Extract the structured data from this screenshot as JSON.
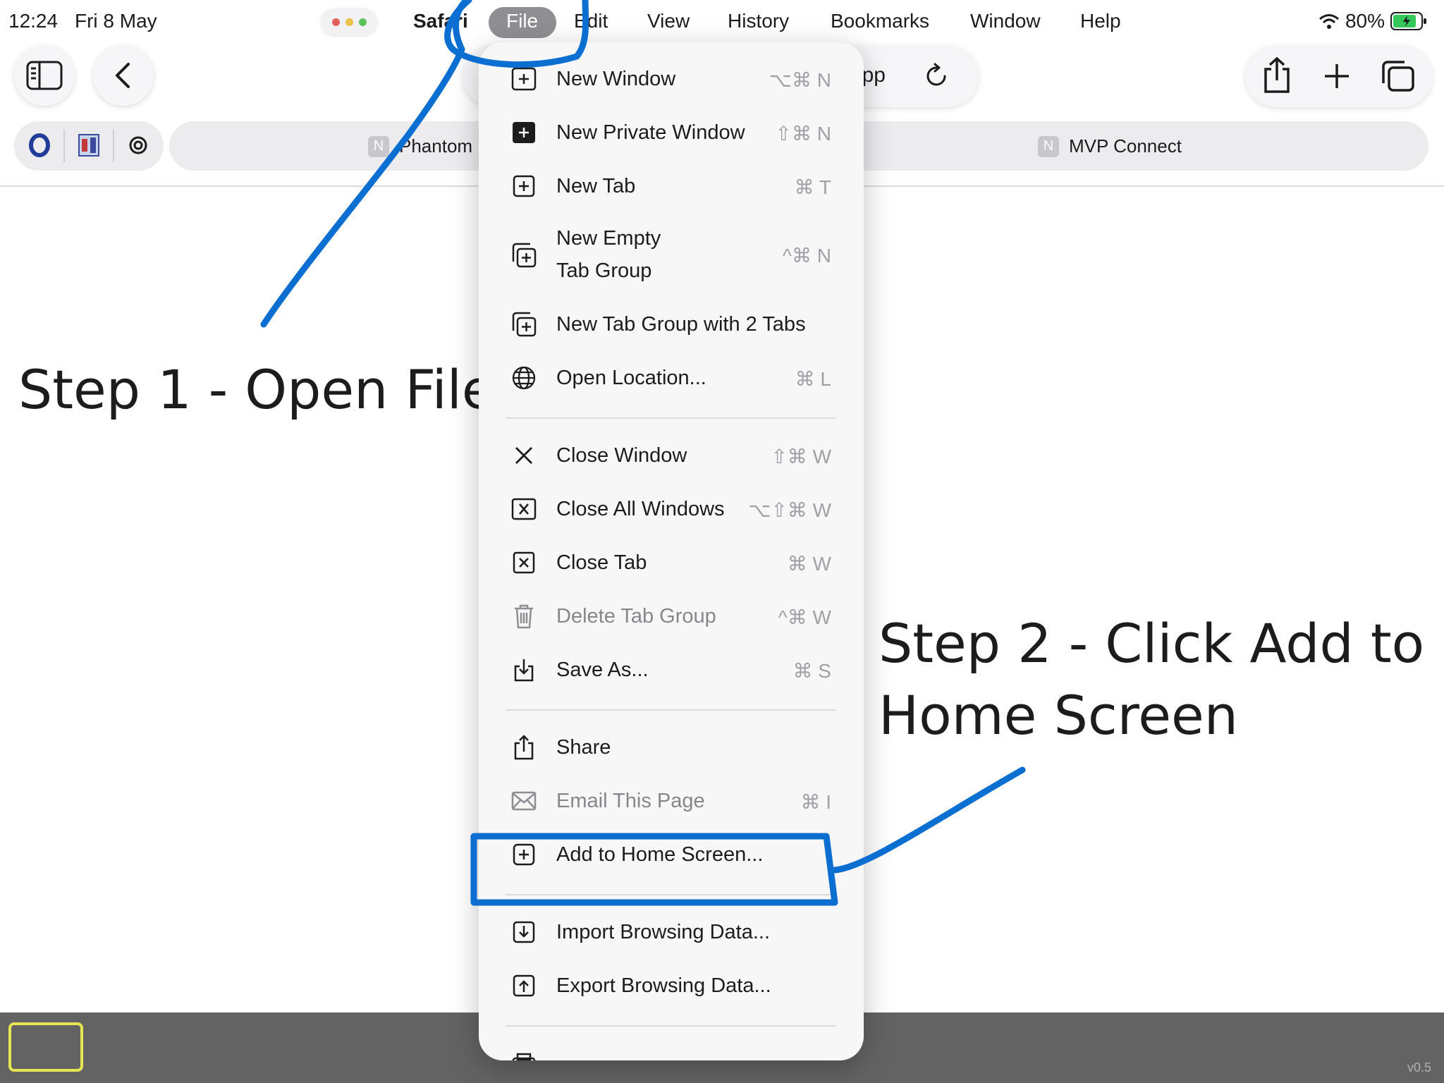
{
  "status_bar": {
    "time": "12:24",
    "date": "Fri 8 May",
    "battery": "80%"
  },
  "menubar": {
    "app": "Safari",
    "items": [
      "File",
      "Edit",
      "View",
      "History",
      "Bookmarks",
      "Window",
      "Help"
    ]
  },
  "toolbar": {
    "address_fragment": "pp"
  },
  "tabs": [
    {
      "title": "Phantom",
      "badge": "N"
    },
    {
      "title": "MVP Connect",
      "badge": "N"
    }
  ],
  "file_menu": {
    "items": [
      {
        "label": "New Window",
        "shortcut": "⌥⌘ N",
        "icon": "new-window-icon"
      },
      {
        "label": "New Private Window",
        "shortcut": "⇧⌘ N",
        "icon": "private-window-icon"
      },
      {
        "label": "New Tab",
        "shortcut": "⌘ T",
        "icon": "new-tab-icon"
      },
      {
        "label": "New Empty",
        "label2": "Tab Group",
        "shortcut": "^⌘ N",
        "icon": "tab-group-icon"
      },
      {
        "label": "New Tab Group with 2 Tabs",
        "shortcut": "",
        "icon": "tab-group-icon"
      },
      {
        "label": "Open Location...",
        "shortcut": "⌘ L",
        "icon": "globe-icon"
      },
      {
        "label": "Close Window",
        "shortcut": "⇧⌘ W",
        "icon": "close-icon"
      },
      {
        "label": "Close All Windows",
        "shortcut": "⌥⇧⌘ W",
        "icon": "close-box-icon"
      },
      {
        "label": "Close Tab",
        "shortcut": "⌘ W",
        "icon": "close-box-icon"
      },
      {
        "label": "Delete Tab Group",
        "shortcut": "^⌘ W",
        "icon": "trash-icon"
      },
      {
        "label": "Save As...",
        "shortcut": "⌘ S",
        "icon": "save-icon"
      },
      {
        "label": "Share",
        "shortcut": "",
        "icon": "share-icon"
      },
      {
        "label": "Email This Page",
        "shortcut": "⌘ I",
        "icon": "envelope-icon"
      },
      {
        "label": "Add to Home Screen...",
        "shortcut": "",
        "icon": "add-box-icon"
      },
      {
        "label": "Import Browsing Data...",
        "shortcut": "",
        "icon": "import-icon"
      },
      {
        "label": "Export Browsing Data...",
        "shortcut": "",
        "icon": "export-icon"
      }
    ]
  },
  "annotations": {
    "step1": "Step 1 - Open File",
    "step2": "Step 2 - Click Add to Home Screen"
  },
  "version": "v0.5",
  "colors": {
    "ink": "#0a6fd1",
    "file_pill": "#8e8e93",
    "bottom_bar": "#636363",
    "highlight": "#e6e652"
  }
}
